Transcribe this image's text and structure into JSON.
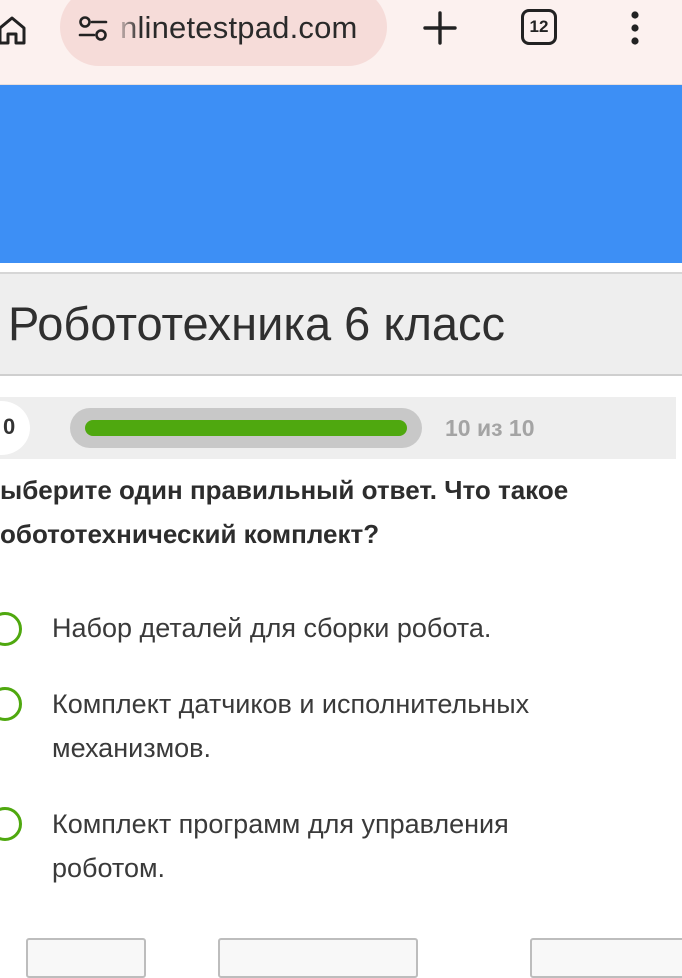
{
  "browser": {
    "url": "nlinetestpad.com",
    "tab_count": "12",
    "icons": {
      "home": "home-icon",
      "site_settings": "tune-icon",
      "new_tab": "plus-icon",
      "menu": "more-vert-icon"
    },
    "colors": {
      "bar_background": "#fcf1ef",
      "url_pill": "#f6dcd9"
    }
  },
  "banner": {
    "color": "#3d8ff5"
  },
  "test": {
    "title": "Робототехника 6 класс"
  },
  "progress": {
    "timer": "0",
    "fraction": 1.0,
    "label": "10 из 10",
    "fill_color": "#4fa80f"
  },
  "question": {
    "lines": [
      "ыберите один правильный ответ. Что такое",
      "обототехнический комплект?"
    ]
  },
  "answers": [
    {
      "lines": [
        "Набор деталей для сборки робота."
      ]
    },
    {
      "lines": [
        "Комплект датчиков и исполнительных",
        "механизмов."
      ]
    },
    {
      "lines": [
        "Комплект программ для управления",
        "роботом."
      ]
    }
  ]
}
